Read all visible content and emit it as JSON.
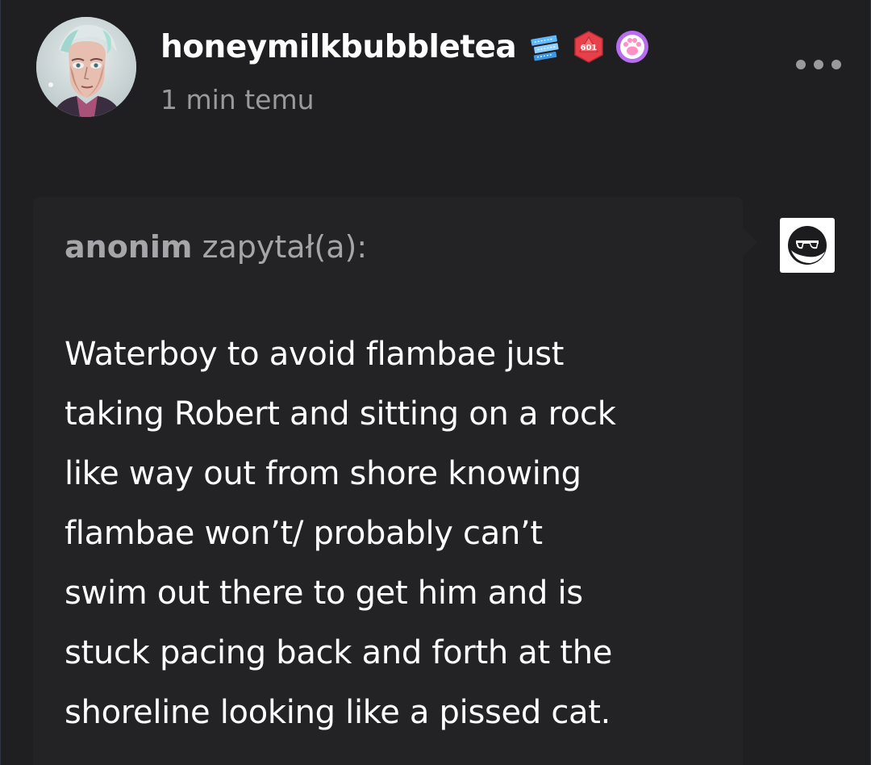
{
  "post": {
    "blog_name": "honeymilkbubbletea",
    "timestamp": "1 min temu",
    "badges": [
      {
        "name": "ticket-badge-icon",
        "color": "#5fb9ff"
      },
      {
        "name": "d20-badge-icon",
        "color": "#e8404a",
        "text": "601"
      },
      {
        "name": "paw-badge-icon",
        "color": "#b86cf0"
      }
    ],
    "more_icon": "more-dots-icon"
  },
  "ask": {
    "asker_name": "anonim",
    "asker_suffix": " zapytał(a):",
    "lines": [
      "Waterboy to avoid flambae just",
      "taking Robert and sitting on a rock",
      "like way out from shore knowing",
      "flambae won’t/ probably can’t",
      "swim out there to get him and is",
      "stuck pacing back and forth at the",
      "shoreline looking like a pissed cat."
    ],
    "anon_avatar_icon": "sunglasses-face-icon"
  },
  "colors": {
    "background": "#1f1f21",
    "ask_box": "#232325",
    "primary_text": "#ffffff",
    "secondary_text": "#9a9a9e"
  }
}
